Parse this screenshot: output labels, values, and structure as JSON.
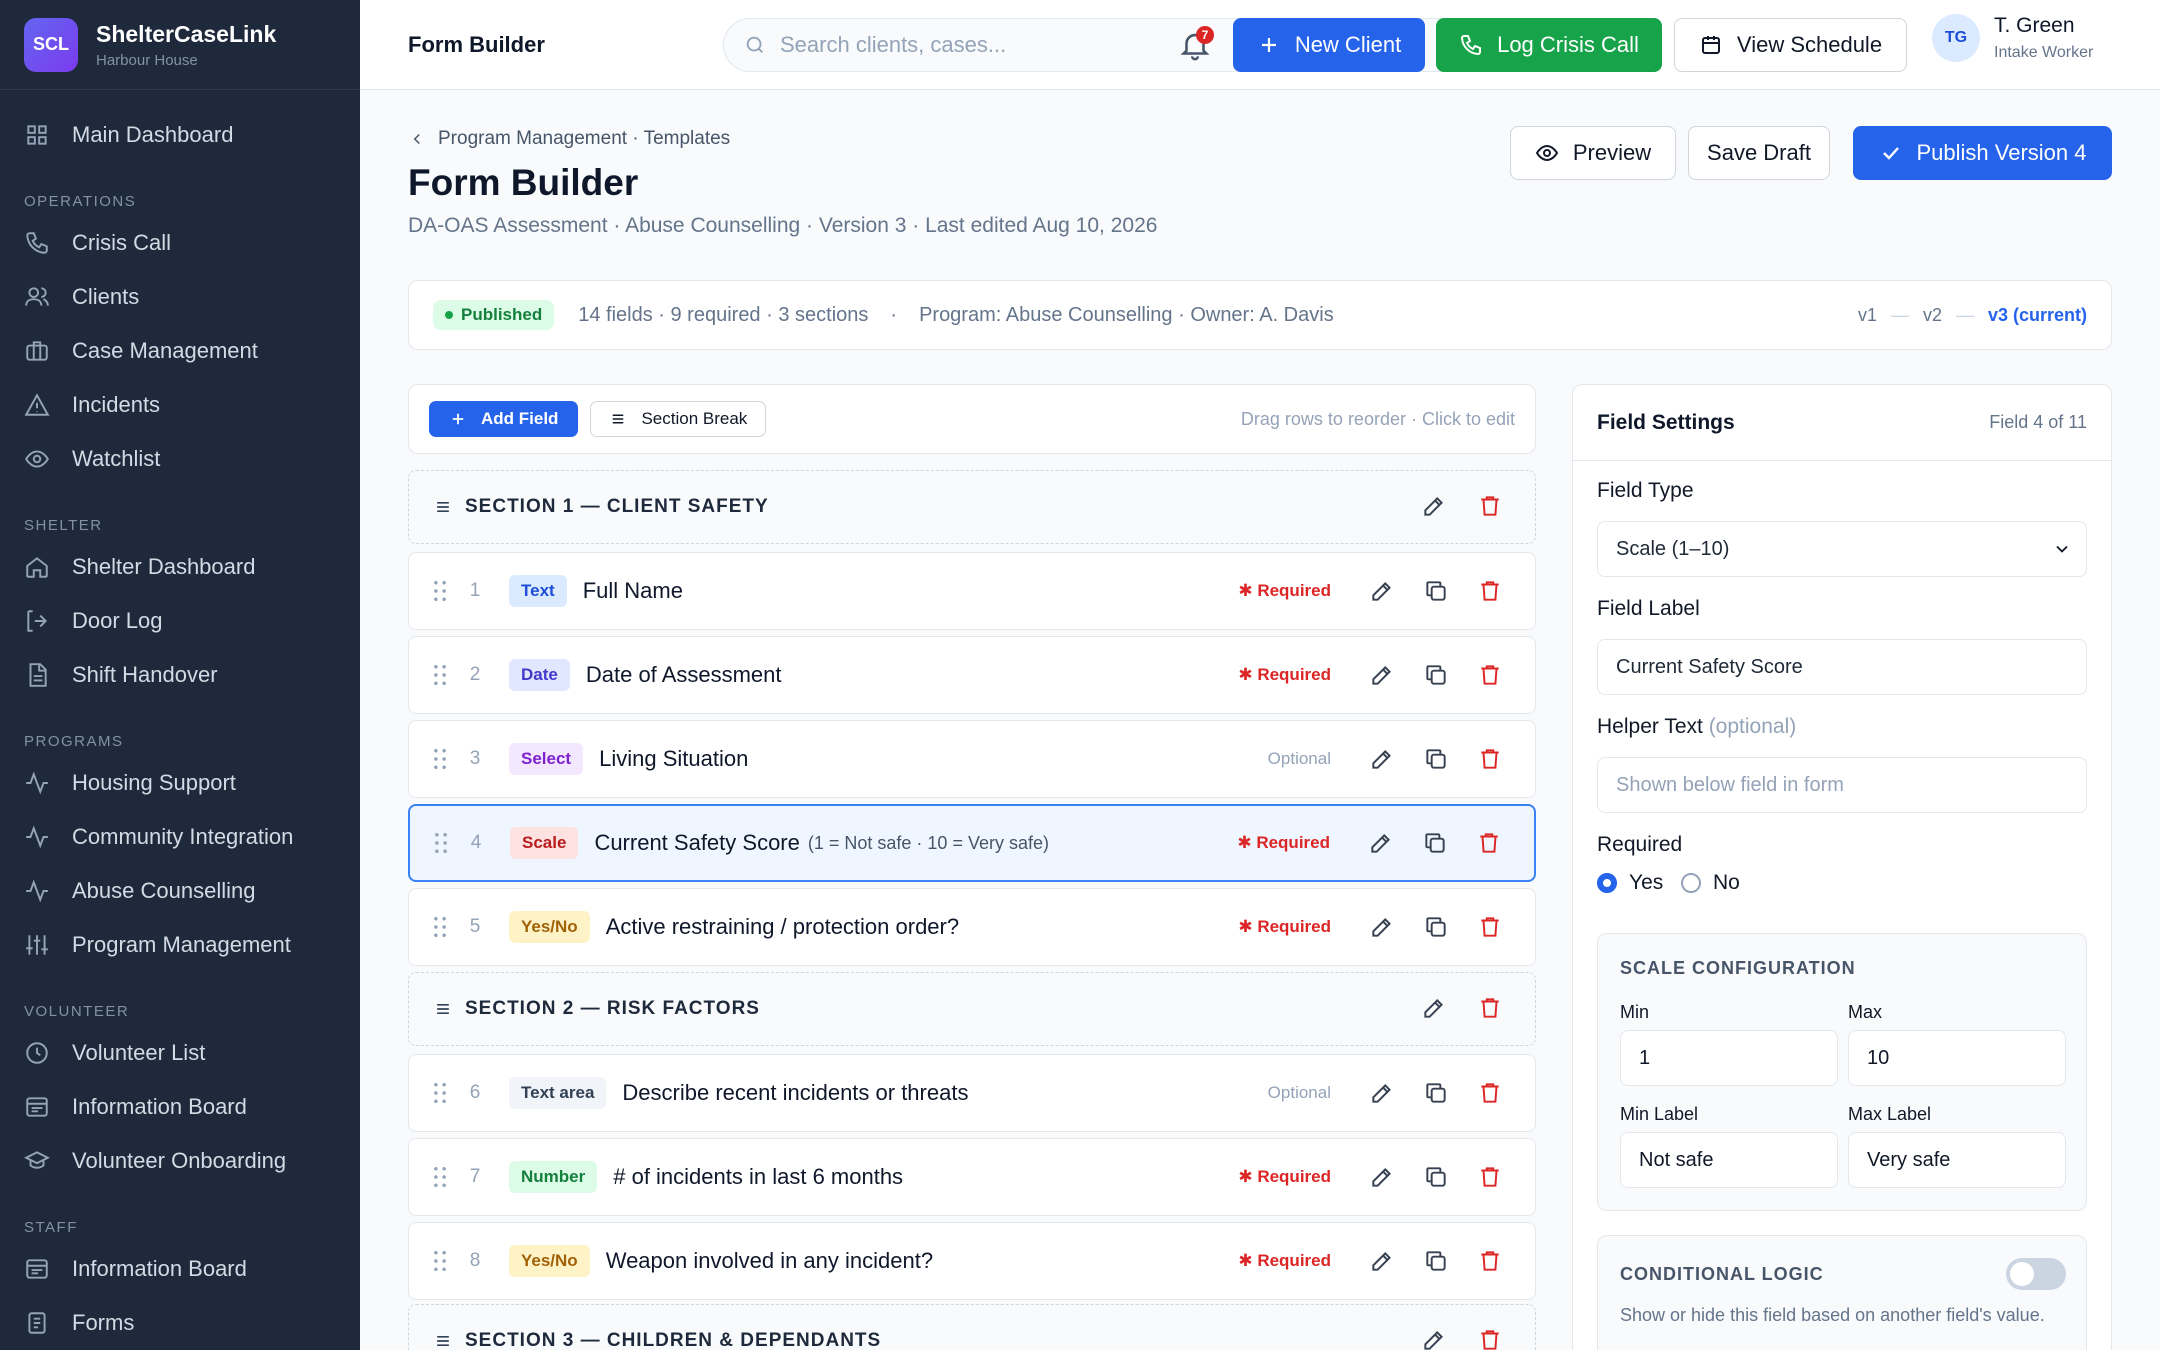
{
  "brand": {
    "logo": "SCL",
    "name": "ShelterCaseLink",
    "sub": "Harbour House"
  },
  "sidebar": {
    "top": {
      "label": "Main Dashboard",
      "icon": "grid-icon"
    },
    "sections": [
      {
        "title": "OPERATIONS",
        "items": [
          {
            "label": "Crisis Call",
            "icon": "phone-icon"
          },
          {
            "label": "Clients",
            "icon": "users-icon"
          },
          {
            "label": "Case Management",
            "icon": "briefcase-icon"
          },
          {
            "label": "Incidents",
            "icon": "warning-icon"
          },
          {
            "label": "Watchlist",
            "icon": "eye-icon"
          }
        ]
      },
      {
        "title": "SHELTER",
        "items": [
          {
            "label": "Shelter Dashboard",
            "icon": "home-icon"
          },
          {
            "label": "Door Log",
            "icon": "door-icon"
          },
          {
            "label": "Shift Handover",
            "icon": "document-icon"
          }
        ]
      },
      {
        "title": "PROGRAMS",
        "items": [
          {
            "label": "Housing Support",
            "icon": "activity-icon"
          },
          {
            "label": "Community Integration",
            "icon": "activity-icon"
          },
          {
            "label": "Abuse Counselling",
            "icon": "activity-icon"
          },
          {
            "label": "Program Management",
            "icon": "sliders-icon"
          }
        ]
      },
      {
        "title": "VOLUNTEER",
        "items": [
          {
            "label": "Volunteer List",
            "icon": "clock-icon"
          },
          {
            "label": "Information Board",
            "icon": "board-icon"
          },
          {
            "label": "Volunteer Onboarding",
            "icon": "graduation-icon"
          }
        ]
      },
      {
        "title": "STAFF",
        "items": [
          {
            "label": "Information Board",
            "icon": "board-icon"
          },
          {
            "label": "Forms",
            "icon": "form-icon"
          }
        ]
      }
    ]
  },
  "topbar": {
    "title": "Form Builder",
    "search_placeholder": "Search clients, cases...",
    "notif_count": "7",
    "new_client": "New Client",
    "log_crisis": "Log Crisis Call",
    "view_schedule": "View Schedule",
    "user": {
      "initials": "TG",
      "name": "T. Green",
      "role": "Intake Worker"
    }
  },
  "header": {
    "breadcrumb": "Program Management · Templates",
    "title": "Form Builder",
    "subtitle": "DA-OAS Assessment · Abuse Counselling · Version 3 · Last edited Aug 10, 2026",
    "preview": "Preview",
    "save_draft": "Save Draft",
    "publish": "Publish Version 4"
  },
  "meta": {
    "status": "Published",
    "counts": "14 fields · 9 required · 3 sections",
    "sep": "·",
    "program": "Program: Abuse Counselling · Owner: A. Davis",
    "versions": [
      "v1",
      "v2",
      "v3 (current)"
    ],
    "dash": "—"
  },
  "toolbar": {
    "add_field": "Add Field",
    "section_break": "Section Break",
    "hint": "Drag rows to reorder · Click to edit"
  },
  "rows": [
    {
      "kind": "section",
      "title": "SECTION 1 — CLIENT SAFETY"
    },
    {
      "kind": "field",
      "num": "1",
      "type": "Text",
      "label": "Full Name",
      "status": "Required"
    },
    {
      "kind": "field",
      "num": "2",
      "type": "Date",
      "label": "Date of Assessment",
      "status": "Required"
    },
    {
      "kind": "field",
      "num": "3",
      "type": "Select",
      "label": "Living Situation",
      "status": "Optional"
    },
    {
      "kind": "field",
      "num": "4",
      "type": "Scale",
      "label": "Current Safety Score",
      "hint": "(1 = Not safe · 10 = Very safe)",
      "status": "Required",
      "selected": true
    },
    {
      "kind": "field",
      "num": "5",
      "type": "Yes/No",
      "label": "Active restraining / protection order?",
      "status": "Required"
    },
    {
      "kind": "section",
      "title": "SECTION 2 — RISK FACTORS"
    },
    {
      "kind": "field",
      "num": "6",
      "type": "Text area",
      "label": "Describe recent incidents or threats",
      "status": "Optional"
    },
    {
      "kind": "field",
      "num": "7",
      "type": "Number",
      "label": "# of incidents in last 6 months",
      "status": "Required"
    },
    {
      "kind": "field",
      "num": "8",
      "type": "Yes/No",
      "label": "Weapon involved in any incident?",
      "status": "Required"
    },
    {
      "kind": "section",
      "title": "SECTION 3 — CHILDREN & DEPENDANTS"
    }
  ],
  "type_colors": {
    "Text": {
      "bg": "#dbeafe",
      "fg": "#1d4ed8"
    },
    "Date": {
      "bg": "#e0e7ff",
      "fg": "#4338ca"
    },
    "Select": {
      "bg": "#f3e8ff",
      "fg": "#7e22ce"
    },
    "Scale": {
      "bg": "#fee2e2",
      "fg": "#b91c1c"
    },
    "Yes/No": {
      "bg": "#fef3c7",
      "fg": "#a16207"
    },
    "Text area": {
      "bg": "#f1f5f9",
      "fg": "#334155"
    },
    "Number": {
      "bg": "#dcfce7",
      "fg": "#15803d"
    }
  },
  "settings": {
    "title": "Field Settings",
    "count": "Field 4 of 11",
    "field_type_label": "Field Type",
    "field_type_value": "Scale (1–10)",
    "field_label_label": "Field Label",
    "field_label_value": "Current Safety Score",
    "helper_label": "Helper Text",
    "helper_optional": "(optional)",
    "helper_placeholder": "Shown below field in form",
    "required_label": "Required",
    "yes": "Yes",
    "no": "No",
    "scale": {
      "title": "SCALE CONFIGURATION",
      "min_label": "Min",
      "min": "1",
      "max_label": "Max",
      "max": "10",
      "minl_label": "Min Label",
      "minl": "Not safe",
      "maxl_label": "Max Label",
      "maxl": "Very safe"
    },
    "cond": {
      "title": "CONDITIONAL LOGIC",
      "desc": "Show or hide this field based on another field's value."
    }
  }
}
